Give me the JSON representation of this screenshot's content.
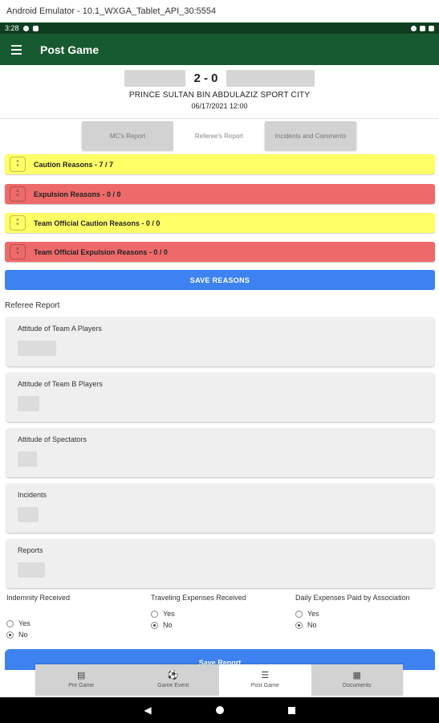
{
  "window": {
    "title": "Android Emulator - 10.1_WXGA_Tablet_API_30:5554"
  },
  "status_bar": {
    "time": "3:28"
  },
  "app_bar": {
    "title": "Post Game"
  },
  "match": {
    "score": "2 - 0",
    "venue": "PRINCE SULTAN BIN ABDULAZIZ SPORT CITY",
    "datetime": "06/17/2021 12:00"
  },
  "tabs": [
    {
      "label": "MC's Report"
    },
    {
      "label": "Referee's Report"
    },
    {
      "label": "Incidents and Comments"
    }
  ],
  "reasons": [
    {
      "label": "Caution Reasons - 7 / 7",
      "color": "#ffff66"
    },
    {
      "label": "Expulsion Reasons - 0 / 0",
      "color": "#ee6a6a"
    },
    {
      "label": "Team Official Caution Reasons - 0 / 0",
      "color": "#ffff66"
    },
    {
      "label": "Team Official Expulsion Reasons - 0 / 0",
      "color": "#ee6a6a"
    }
  ],
  "save_reasons_label": "SAVE REASONS",
  "referee_report": {
    "title": "Referee Report",
    "fields": [
      {
        "label": "Attitude of Team A Players"
      },
      {
        "label": "Attitude of Team B Players"
      },
      {
        "label": "Attitude of Spectators"
      },
      {
        "label": "Incidents"
      },
      {
        "label": "Reports"
      }
    ]
  },
  "options": [
    {
      "label": "Indemnity Received",
      "yes": "Yes",
      "no": "No",
      "selected": "No"
    },
    {
      "label": "Traveling Expenses Received",
      "yes": "Yes",
      "no": "No",
      "selected": "No"
    },
    {
      "label": "Daily Expenses Paid by Association",
      "yes": "Yes",
      "no": "No",
      "selected": "No"
    }
  ],
  "save_report_label": "Save Report",
  "bottom_nav": [
    {
      "label": "Pre Game",
      "icon": "clipboard-icon"
    },
    {
      "label": "Game Event",
      "icon": "soccer-ball-icon"
    },
    {
      "label": "Post Game",
      "icon": "list-icon"
    },
    {
      "label": "Documents",
      "icon": "document-icon"
    }
  ],
  "colors": {
    "app_bar": "#175a31",
    "status_bar": "#0f3d21",
    "primary_button": "#3d82f0"
  }
}
